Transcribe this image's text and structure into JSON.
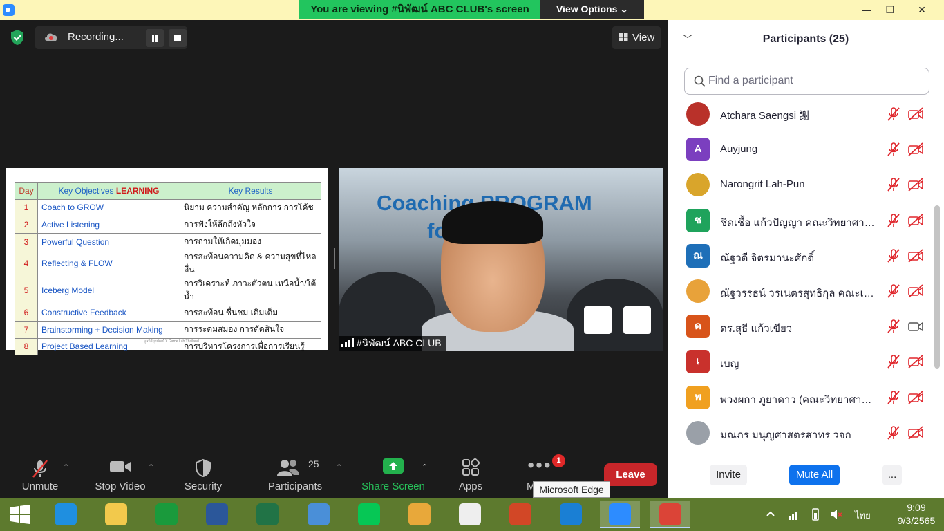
{
  "titlebar": {
    "banner": "You are viewing #นิพัฒน์ ABC CLUB's screen",
    "view_options": "View Options ⌄",
    "minimize": "—",
    "restore": "❐",
    "close": "✕"
  },
  "meeting": {
    "recording_label": "Recording...",
    "view_label": "View",
    "video_name": "#นิพัฒน์ ABC CLUB",
    "video_bg_line1": "Coaching PROGRAM",
    "video_bg_line2": "fo     rer"
  },
  "slide": {
    "headers": {
      "day": "Day",
      "objective": "Key Objectives ",
      "objective_accent": "LEARNING",
      "result": "Key Results"
    },
    "rows": [
      {
        "day": "1",
        "objective": "Coach to GROW",
        "result": "นิยาม ความสำคัญ หลักการ การโค้ช"
      },
      {
        "day": "2",
        "objective": "Active Listening",
        "result": "การฟังให้ลึกถึงหัวใจ"
      },
      {
        "day": "3",
        "objective": "Powerful Question",
        "result": "การถามให้เกิดมุมมอง"
      },
      {
        "day": "4",
        "objective": "Reflecting & FLOW",
        "result": "การสะท้อนความคิด & ความสุขที่ไหลลื่น"
      },
      {
        "day": "5",
        "objective": "Iceberg Model",
        "result": "การวิเคราะห์ ภาวะตัวตน เหนือน้ำ/ใต้น้ำ"
      },
      {
        "day": "6",
        "objective": "Constructive Feedback",
        "result": "การสะท้อน ชื่นชม เติมเต็ม"
      },
      {
        "day": "7",
        "objective": "Brainstorming + Decision Making",
        "result": "การระดมสมอง การตัดสินใจ"
      },
      {
        "day": "8",
        "objective": "Project Based Learning",
        "result": "การบริหารโครงการเพื่อการเรียนรู้"
      }
    ],
    "footer": "มูลนิธิยุวพัฒน์ X Game Lab Thailand"
  },
  "toolbar": {
    "unmute": "Unmute",
    "stop_video": "Stop Video",
    "security": "Security",
    "participants": "Participants",
    "participants_count": "25",
    "share_screen": "Share Screen",
    "apps": "Apps",
    "more": "M",
    "more_badge": "1",
    "leave": "Leave",
    "tooltip": "Microsoft Edge"
  },
  "panel": {
    "title": "Participants (25)",
    "search_placeholder": "Find a participant",
    "participants": [
      {
        "name": "Atchara Saengsi 謝",
        "initial": "",
        "color": "#b9312a",
        "video_on": false
      },
      {
        "name": "Auyjung",
        "initial": "A",
        "color": "#7b3fbf",
        "video_on": false
      },
      {
        "name": "Narongrit Lah-Pun",
        "initial": "",
        "color": "#d9a52b",
        "video_on": false
      },
      {
        "name": "ชิดเชื้อ  แก้วปัญญา คณะวิทยาศาสตร์",
        "initial": "ช",
        "color": "#1fa35c",
        "video_on": false
      },
      {
        "name": "ณัฐวดี จิตรมานะศักดิ์",
        "initial": "ณ",
        "color": "#1e6fb8",
        "video_on": false
      },
      {
        "name": "ณัฐวรรธน์ วรเนตรสุทธิกุล คณะเทคโนโลยี",
        "initial": "",
        "color": "#e8a23a",
        "video_on": false
      },
      {
        "name": "ดร.สุธี  แก้วเขียว",
        "initial": "ด",
        "color": "#d8541a",
        "video_on": true
      },
      {
        "name": "เบญ",
        "initial": "เ",
        "color": "#c9312c",
        "video_on": false
      },
      {
        "name": "พวงผกา ภูยาดาว (คณะวิทยาศาสตร์และ",
        "initial": "พ",
        "color": "#f0a020",
        "video_on": false
      },
      {
        "name": "มณภร มนุญศาสตรสาทร วจก",
        "initial": "",
        "color": "#9aa0a8",
        "video_on": false
      }
    ],
    "invite": "Invite",
    "mute_all": "Mute All",
    "more": "..."
  },
  "taskbar": {
    "lang": "ไทย",
    "time": "9:09",
    "date": "9/3/2565",
    "apps": [
      "start-icon",
      "internet-explorer-icon",
      "file-explorer-icon",
      "store-icon",
      "word-icon",
      "excel-icon",
      "math-icon",
      "line-icon",
      "paint-icon",
      "lisrel-icon",
      "powerpoint-icon",
      "edge-icon",
      "zoom-icon",
      "chrome-icon"
    ]
  }
}
